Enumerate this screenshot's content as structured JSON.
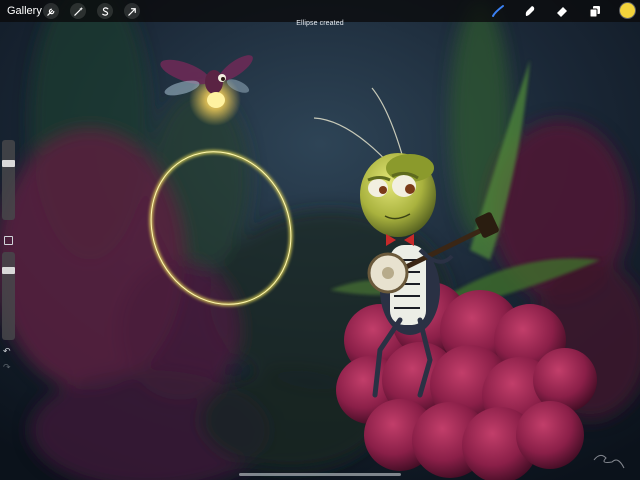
{
  "toolbar": {
    "gallery_label": "Gallery",
    "left_tools": [
      {
        "name": "wrench-icon",
        "label": "Actions"
      },
      {
        "name": "magic-wand-icon",
        "label": "Adjustments"
      },
      {
        "name": "selection-s-icon",
        "label": "Selection"
      },
      {
        "name": "arrow-cursor-icon",
        "label": "Transform"
      }
    ],
    "right_tools": [
      {
        "name": "brush-icon",
        "label": "Paint",
        "active": true
      },
      {
        "name": "smudge-icon",
        "label": "Smudge"
      },
      {
        "name": "eraser-icon",
        "label": "Erase"
      },
      {
        "name": "layers-icon",
        "label": "Layers"
      }
    ],
    "active_color": "#f3d33b",
    "accent_color": "#3b82f6"
  },
  "status": {
    "message": "Ellipse created"
  },
  "sidebar": {
    "brush_size": 0.72,
    "brush_opacity": 0.82,
    "undo_icon": "undo-arrow-icon",
    "redo_icon": "redo-arrow-icon"
  },
  "canvas": {
    "ellipse_color": "#f1e35a",
    "firefly_glow": "#ffd65a"
  }
}
